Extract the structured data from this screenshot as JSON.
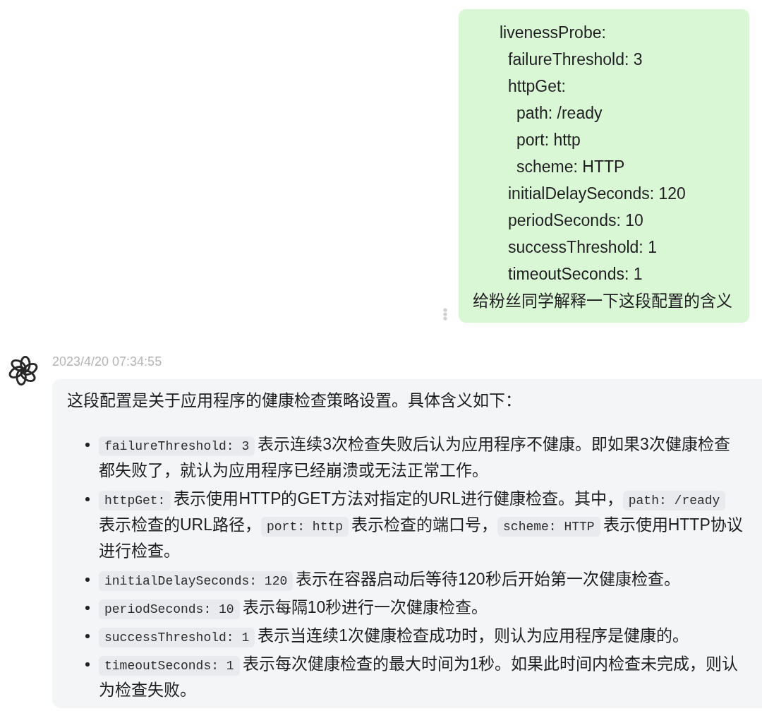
{
  "user_message": {
    "lines": [
      {
        "text": "livenessProbe:",
        "children": [
          {
            "text": "failureThreshold: 3"
          },
          {
            "text": "httpGet:",
            "children": [
              {
                "text": "path: /ready"
              },
              {
                "text": "port: http"
              },
              {
                "text": "scheme: HTTP"
              }
            ]
          },
          {
            "text": "initialDelaySeconds: 120"
          },
          {
            "text": "periodSeconds: 10"
          },
          {
            "text": "successThreshold: 1"
          },
          {
            "text": "timeoutSeconds: 1"
          }
        ]
      }
    ],
    "question": "给粉丝同学解释一下这段配置的含义"
  },
  "assistant_message": {
    "timestamp": "2023/4/20 07:34:55",
    "intro": "这段配置是关于应用程序的健康检查策略设置。具体含义如下：",
    "items": [
      {
        "segments": [
          {
            "kind": "code",
            "text": "failureThreshold: 3"
          },
          {
            "kind": "text",
            "text": "表示连续3次检查失败后认为应用程序不健康。即如果3次健康检查都失败了，就认为应用程序已经崩溃或无法正常工作。"
          }
        ]
      },
      {
        "segments": [
          {
            "kind": "code",
            "text": "httpGet:"
          },
          {
            "kind": "text",
            "text": "表示使用HTTP的GET方法对指定的URL进行健康检查。其中，"
          },
          {
            "kind": "code",
            "text": "path: /ready"
          },
          {
            "kind": "text",
            "text": "表示检查的URL路径，"
          },
          {
            "kind": "code",
            "text": "port: http"
          },
          {
            "kind": "text",
            "text": "表示检查的端口号，"
          },
          {
            "kind": "code",
            "text": "scheme: HTTP"
          },
          {
            "kind": "text",
            "text": "表示使用HTTP协议进行检查。"
          }
        ]
      },
      {
        "segments": [
          {
            "kind": "code",
            "text": "initialDelaySeconds: 120"
          },
          {
            "kind": "text",
            "text": "表示在容器启动后等待120秒后开始第一次健康检查。"
          }
        ]
      },
      {
        "segments": [
          {
            "kind": "code",
            "text": "periodSeconds: 10"
          },
          {
            "kind": "text",
            "text": "表示每隔10秒进行一次健康检查。"
          }
        ]
      },
      {
        "segments": [
          {
            "kind": "code",
            "text": "successThreshold: 1"
          },
          {
            "kind": "text",
            "text": "表示当连续1次健康检查成功时，则认为应用程序是健康的。"
          }
        ]
      },
      {
        "segments": [
          {
            "kind": "code",
            "text": "timeoutSeconds: 1"
          },
          {
            "kind": "text",
            "text": "表示每次健康检查的最大时间为1秒。如果此时间内检查未完成，则认为检查失败。"
          }
        ]
      }
    ]
  }
}
